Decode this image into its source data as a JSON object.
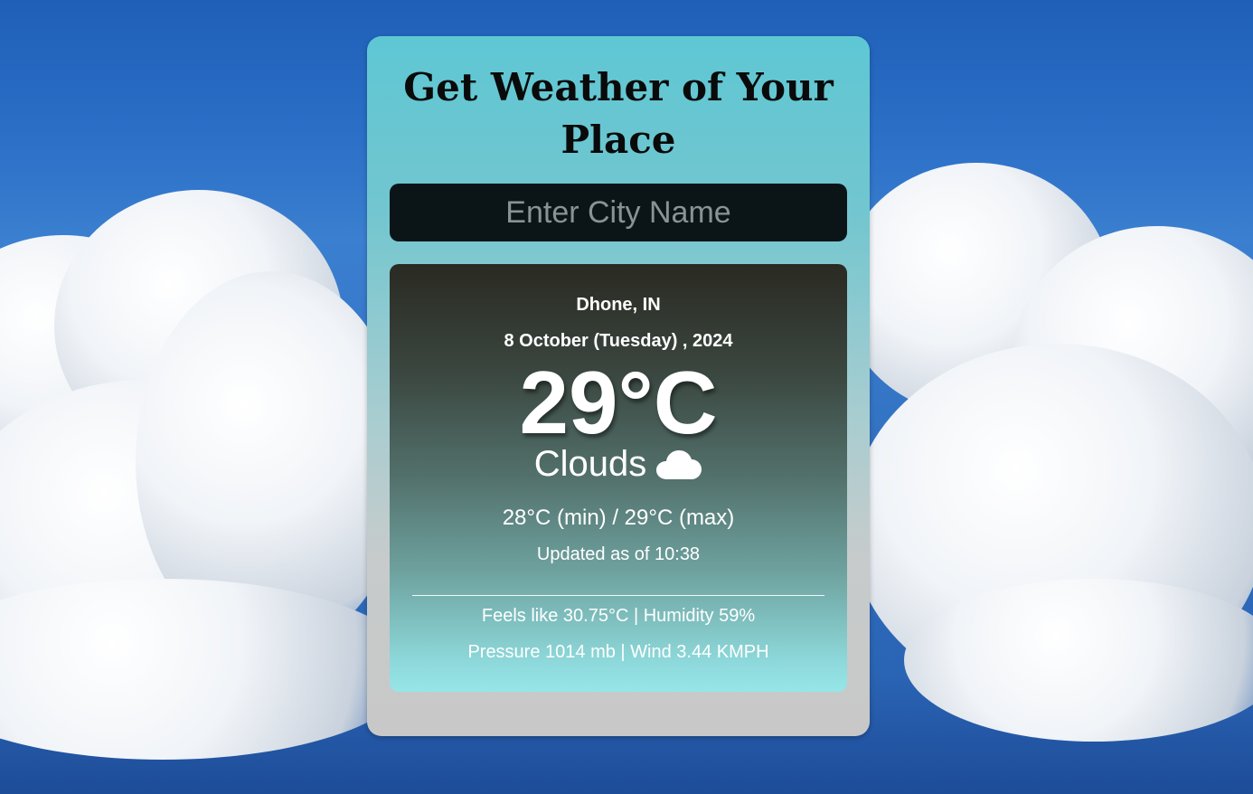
{
  "header": {
    "title": "Get Weather of Your Place"
  },
  "search": {
    "placeholder": "Enter City Name",
    "value": ""
  },
  "weather": {
    "location": "Dhone, IN",
    "date": "8 October (Tuesday) , 2024",
    "temperature": "29°C",
    "condition": "Clouds",
    "condition_icon": "cloud-icon",
    "min_max": "28°C (min) / 29°C (max)",
    "updated": "Updated as of 10:38",
    "feels_humidity": "Feels like 30.75°C | Humidity 59%",
    "pressure_wind": "Pressure 1014 mb | Wind 3.44 KMPH"
  },
  "colors": {
    "search_bg": "#0b1518",
    "card_top": "#5ec7d4",
    "card_bottom": "#c8c8c8",
    "weather_top": "#2a2a22",
    "weather_bottom": "#96e6e8"
  }
}
